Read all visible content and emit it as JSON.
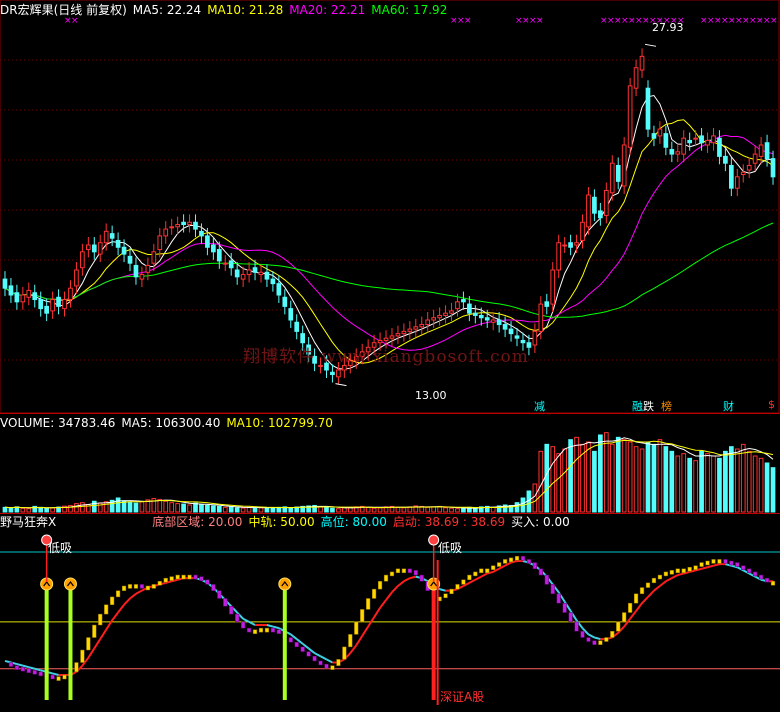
{
  "price_panel": {
    "title": "DR宏辉果(日线 前复权)",
    "indicators": [
      {
        "label": "MA5: 22.24",
        "color": "#ffffff"
      },
      {
        "label": "MA10: 21.28",
        "color": "#ffff00"
      },
      {
        "label": "MA20: 22.21",
        "color": "#ff00ff"
      },
      {
        "label": "MA60: 17.92",
        "color": "#00ff00"
      }
    ],
    "high_label": "27.93",
    "low_label": "13.00",
    "watermark": "翔博软件 www.xiangbosoft.com",
    "event_tags": [
      {
        "text": "减",
        "color": "#00ffff"
      },
      {
        "text": "融",
        "color": "#00ffff"
      },
      {
        "text": "跌",
        "color": "#ffffff"
      },
      {
        "text": "榜",
        "color": "#ff8c00"
      },
      {
        "text": "财",
        "color": "#00ffff"
      },
      {
        "text": "$",
        "color": "#ff3333"
      }
    ]
  },
  "volume_panel": {
    "indicators": [
      {
        "label": "VOLUME: 34783.46",
        "color": "#ffffff"
      },
      {
        "label": "MA5: 106300.40",
        "color": "#ffffff"
      },
      {
        "label": "MA10: 102799.70",
        "color": "#ffff00"
      }
    ]
  },
  "indicator_panel": {
    "title": "野马狂奔X",
    "params": [
      {
        "label": "底部区域: 20.00",
        "color": "#ff8080"
      },
      {
        "label": "中轨: 50.00",
        "color": "#ffff00"
      },
      {
        "label": "高位: 80.00",
        "color": "#00ffff"
      },
      {
        "label": "启动: 38.69 : 38.69",
        "color": "#ff3030"
      },
      {
        "label": "买入: 0.00",
        "color": "#ffffff"
      }
    ],
    "low_buy_label": "低吸",
    "market_label": "深证A股"
  },
  "colors": {
    "up": "#ff3232",
    "down": "#54fcfc",
    "ma5": "#ffffff",
    "ma10": "#ffff00",
    "ma20": "#ff00ff",
    "ma60": "#00ff00",
    "grid": "#8b0000"
  },
  "chart_data": [
    {
      "type": "candlestick",
      "title": "DR宏辉果(日线 前复权)",
      "x": [
        1,
        2,
        3,
        4,
        5,
        6,
        7,
        8,
        9,
        10,
        11,
        12,
        13,
        14,
        15,
        16,
        17,
        18,
        19,
        20,
        21,
        22,
        23,
        24,
        25,
        26,
        27,
        28,
        29,
        30,
        31,
        32,
        33,
        34,
        35,
        36,
        37,
        38,
        39,
        40,
        41,
        42,
        43,
        44,
        45,
        46,
        47,
        48,
        49,
        50,
        51,
        52,
        53,
        54,
        55,
        56,
        57,
        58,
        59,
        60,
        61,
        62,
        63,
        64,
        65,
        66,
        67,
        68,
        69,
        70,
        71,
        72,
        73,
        74,
        75,
        76,
        77,
        78,
        79,
        80,
        81,
        82,
        83,
        84,
        85,
        86,
        87,
        88,
        89,
        90,
        91,
        92,
        93,
        94,
        95,
        96,
        97,
        98,
        99,
        100,
        101,
        102,
        103,
        104,
        105,
        106,
        107,
        108,
        109,
        110,
        111,
        112,
        113,
        114,
        115,
        116,
        117,
        118,
        119,
        120,
        121,
        122,
        123,
        124,
        125,
        126,
        127,
        128,
        129,
        130
      ],
      "open": [
        17.6,
        17.3,
        17.0,
        16.6,
        16.8,
        17.0,
        16.7,
        16.4,
        16.2,
        16.8,
        16.3,
        16.7,
        17.3,
        18.1,
        18.9,
        19.1,
        18.7,
        19.2,
        19.6,
        19.3,
        19.0,
        18.6,
        18.2,
        17.6,
        17.9,
        18.3,
        18.9,
        19.5,
        19.9,
        19.9,
        20.1,
        20.0,
        20.1,
        19.7,
        19.5,
        19.1,
        18.9,
        18.3,
        18.4,
        18.0,
        17.6,
        17.8,
        18.1,
        17.8,
        17.9,
        17.6,
        17.4,
        16.8,
        16.3,
        15.7,
        15.2,
        14.7,
        14.2,
        13.8,
        13.9,
        13.5,
        13.3,
        13.6,
        13.8,
        14.0,
        14.2,
        14.4,
        14.6,
        14.8,
        14.9,
        15.0,
        15.1,
        15.2,
        15.3,
        15.4,
        15.5,
        15.6,
        15.8,
        15.9,
        16.0,
        16.1,
        16.3,
        16.7,
        16.5,
        16.1,
        16.0,
        15.9,
        15.7,
        15.8,
        15.6,
        15.4,
        15.1,
        14.9,
        14.8,
        14.7,
        15.3,
        16.6,
        16.5,
        18.0,
        19.1,
        19.2,
        19.1,
        19.3,
        19.9,
        21.2,
        20.6,
        20.4,
        21.4,
        22.6,
        21.7,
        23.4,
        26.0,
        26.8,
        26.0,
        24.0,
        23.9,
        24.0,
        23.3,
        23.1,
        23.1,
        23.7,
        23.8,
        23.9,
        23.5,
        23.6,
        23.8,
        23.0,
        22.6,
        21.6,
        22.2,
        22.4,
        22.7,
        23.0,
        23.6,
        22.9
      ],
      "close": [
        17.2,
        16.9,
        16.6,
        16.9,
        17.1,
        16.7,
        16.3,
        16.1,
        16.7,
        16.4,
        16.7,
        17.2,
        18.0,
        18.8,
        19.1,
        18.8,
        19.2,
        19.7,
        19.4,
        19.0,
        18.7,
        18.3,
        17.7,
        17.8,
        18.2,
        18.8,
        19.5,
        19.8,
        19.9,
        20.0,
        20.0,
        20.1,
        19.8,
        19.5,
        19.0,
        18.8,
        18.4,
        18.3,
        18.1,
        17.7,
        17.8,
        18.0,
        17.9,
        17.9,
        17.6,
        17.4,
        16.9,
        16.4,
        15.8,
        15.3,
        14.8,
        14.3,
        13.9,
        13.8,
        13.6,
        13.4,
        13.6,
        13.8,
        14.0,
        14.2,
        14.4,
        14.6,
        14.8,
        14.9,
        15.0,
        15.1,
        15.2,
        15.3,
        15.4,
        15.5,
        15.6,
        15.8,
        15.9,
        16.0,
        16.1,
        16.2,
        16.6,
        16.6,
        16.1,
        16.0,
        15.9,
        15.8,
        15.8,
        15.6,
        15.4,
        15.2,
        15.0,
        14.8,
        14.6,
        15.3,
        16.5,
        16.4,
        18.0,
        19.2,
        19.1,
        19.0,
        19.2,
        20.1,
        21.3,
        20.5,
        20.3,
        21.5,
        22.7,
        21.9,
        23.5,
        26.1,
        26.9,
        27.4,
        24.2,
        23.8,
        24.2,
        23.4,
        23.1,
        23.2,
        23.8,
        23.6,
        23.8,
        23.6,
        23.7,
        23.9,
        23.0,
        22.7,
        21.6,
        22.1,
        22.3,
        22.6,
        23.1,
        23.5,
        22.9,
        22.1
      ],
      "series": [
        {
          "name": "MA5",
          "latest": 22.24
        },
        {
          "name": "MA10",
          "latest": 21.28
        },
        {
          "name": "MA20",
          "latest": 22.21
        },
        {
          "name": "MA60",
          "latest": 17.92
        }
      ],
      "high_marker": 27.93,
      "low_marker": 13.0,
      "ylim": [
        12.5,
        29.0
      ]
    },
    {
      "type": "bar",
      "title": "VOLUME",
      "latest": 34783.46,
      "ma5": 106300.4,
      "ma10": 102799.7,
      "values": [
        20,
        18,
        22,
        16,
        14,
        24,
        20,
        15,
        18,
        21,
        25,
        28,
        36,
        40,
        32,
        46,
        38,
        44,
        50,
        60,
        48,
        42,
        38,
        44,
        52,
        58,
        54,
        46,
        40,
        36,
        34,
        30,
        38,
        32,
        28,
        26,
        24,
        20,
        22,
        18,
        17,
        20,
        22,
        18,
        16,
        18,
        20,
        22,
        19,
        21,
        24,
        26,
        28,
        22,
        20,
        16,
        14,
        18,
        20,
        22,
        24,
        20,
        16,
        18,
        22,
        24,
        20,
        18,
        22,
        26,
        24,
        20,
        22,
        24,
        18,
        16,
        14,
        16,
        20,
        18,
        22,
        24,
        20,
        26,
        30,
        28,
        40,
        60,
        90,
        120,
        260,
        290,
        280,
        250,
        270,
        310,
        320,
        290,
        300,
        260,
        330,
        340,
        290,
        320,
        310,
        300,
        280,
        270,
        300,
        290,
        310,
        280,
        260,
        240,
        250,
        230,
        220,
        260,
        250,
        240,
        230,
        260,
        280,
        270,
        290,
        260,
        240,
        230,
        210,
        190
      ],
      "ylim": [
        0,
        360
      ]
    },
    {
      "type": "line",
      "title": "野马狂奔X",
      "levels": {
        "底部区域": 20.0,
        "中轨": 50.0,
        "高位": 80.0
      },
      "x": [
        1,
        2,
        3,
        4,
        5,
        6,
        7,
        8,
        9,
        10,
        11,
        12,
        13,
        14,
        15,
        16,
        17,
        18,
        19,
        20,
        21,
        22,
        23,
        24,
        25,
        26,
        27,
        28,
        29,
        30,
        31,
        32,
        33,
        34,
        35,
        36,
        37,
        38,
        39,
        40,
        41,
        42,
        43,
        44,
        45,
        46,
        47,
        48,
        49,
        50,
        51,
        52,
        53,
        54,
        55,
        56,
        57,
        58,
        59,
        60,
        61,
        62,
        63,
        64,
        65,
        66,
        67,
        68,
        69,
        70,
        71,
        72,
        73,
        74,
        75,
        76,
        77,
        78,
        79,
        80,
        81,
        82,
        83,
        84,
        85,
        86,
        87,
        88,
        89,
        90,
        91,
        92,
        93,
        94,
        95,
        96,
        97,
        98,
        99,
        100,
        101,
        102,
        103,
        104,
        105,
        106,
        107,
        108,
        109,
        110,
        111,
        112,
        113,
        114,
        115,
        116,
        117,
        118,
        119,
        120,
        121,
        122,
        123,
        124,
        125,
        126,
        127,
        128,
        129,
        130
      ],
      "fast": [
        24,
        22,
        21,
        20,
        19,
        18,
        17,
        16,
        15,
        15,
        16,
        18,
        24,
        32,
        40,
        48,
        55,
        61,
        66,
        70,
        73,
        74,
        74,
        73,
        73,
        74,
        76,
        78,
        79,
        80,
        80,
        80,
        79,
        77,
        74,
        70,
        65,
        60,
        55,
        50,
        46,
        44,
        45,
        46,
        46,
        45,
        43,
        40,
        37,
        34,
        31,
        28,
        25,
        23,
        22,
        22,
        26,
        34,
        42,
        50,
        58,
        65,
        71,
        76,
        80,
        82,
        84,
        84,
        83,
        80,
        76,
        70,
        66,
        66,
        68,
        71,
        74,
        77,
        80,
        82,
        84,
        84,
        86,
        88,
        90,
        91,
        92,
        90,
        88,
        84,
        80,
        74,
        68,
        62,
        56,
        50,
        44,
        40,
        38,
        37,
        38,
        40,
        44,
        50,
        56,
        62,
        68,
        72,
        75,
        78,
        80,
        82,
        83,
        84,
        84,
        85,
        86,
        88,
        89,
        90,
        90,
        89,
        88,
        86,
        84,
        82,
        80,
        78,
        76,
        76
      ],
      "slow": [
        25,
        24,
        23,
        22,
        21,
        20,
        19,
        18,
        17,
        16,
        16,
        16,
        18,
        22,
        27,
        33,
        39,
        45,
        51,
        56,
        61,
        65,
        68,
        70,
        72,
        73,
        74,
        75,
        76,
        77,
        78,
        78,
        78,
        77,
        75,
        72,
        68,
        64,
        60,
        56,
        52,
        50,
        48,
        48,
        48,
        47,
        46,
        44,
        42,
        39,
        36,
        33,
        30,
        28,
        26,
        24,
        24,
        26,
        30,
        35,
        41,
        47,
        53,
        59,
        64,
        69,
        73,
        76,
        78,
        79,
        78,
        76,
        73,
        71,
        70,
        70,
        71,
        73,
        75,
        77,
        79,
        81,
        82,
        84,
        86,
        88,
        89,
        89,
        88,
        86,
        83,
        79,
        74,
        69,
        63,
        57,
        51,
        46,
        42,
        40,
        39,
        39,
        40,
        43,
        47,
        52,
        57,
        62,
        66,
        70,
        73,
        76,
        78,
        80,
        81,
        82,
        83,
        84,
        85,
        86,
        87,
        87,
        86,
        85,
        83,
        81,
        79,
        77,
        76,
        76
      ],
      "buy_signals_at": [
        8,
        12,
        48,
        73
      ],
      "ylim": [
        0,
        105
      ]
    }
  ]
}
